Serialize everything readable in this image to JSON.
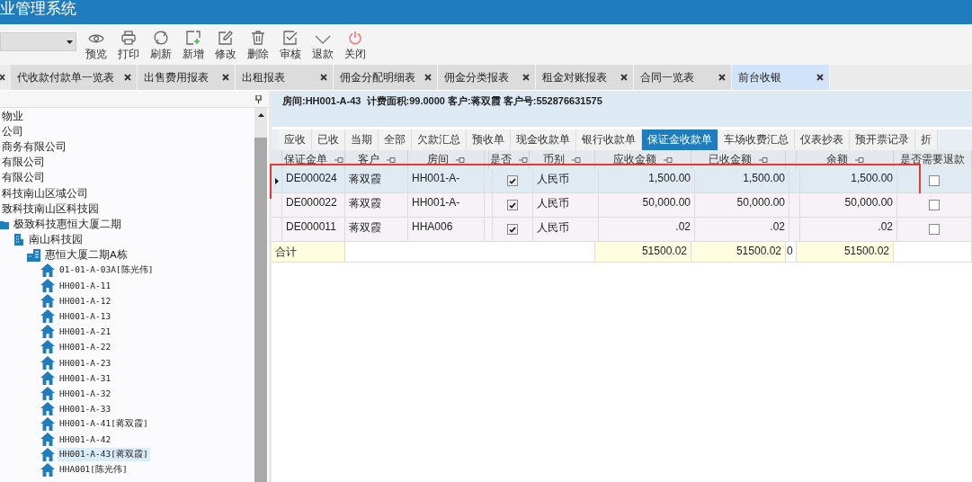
{
  "window": {
    "title": "业管理系统"
  },
  "toolbar": [
    {
      "label": "预览",
      "kind": "preview"
    },
    {
      "label": "打印",
      "kind": "print"
    },
    {
      "label": "刷新",
      "kind": "refresh"
    },
    {
      "label": "新增",
      "kind": "add"
    },
    {
      "label": "修改",
      "kind": "edit"
    },
    {
      "label": "删除",
      "kind": "delete"
    },
    {
      "label": "审核",
      "kind": "audit"
    },
    {
      "label": "退款",
      "kind": "refund"
    },
    {
      "label": "关闭",
      "kind": "close"
    }
  ],
  "tabs": [
    {
      "label": "代收款付款单一览表",
      "selected": false
    },
    {
      "label": "出售费用报表",
      "selected": false
    },
    {
      "label": "出租报表",
      "selected": false
    },
    {
      "label": "佣金分配明细表",
      "selected": false
    },
    {
      "label": "佣金分类报表",
      "selected": false
    },
    {
      "label": "租金对账报表",
      "selected": false
    },
    {
      "label": "合同一览表",
      "selected": false
    },
    {
      "label": "前台收银",
      "selected": true
    }
  ],
  "tree": [
    {
      "label": "物业"
    },
    {
      "label": "公司"
    },
    {
      "label": "商务有限公司"
    },
    {
      "label": "有限公司"
    },
    {
      "label": "有限公司"
    },
    {
      "label": "科技南山区域公司"
    },
    {
      "label": "致科技南山区科技园",
      "children": [
        {
          "label": "极致科技惠恒大厦二期",
          "kind": "estate",
          "children": [
            {
              "label": "南山科技园",
              "kind": "park",
              "children": [
                {
                  "label": "惠恒大厦二期A栋",
                  "kind": "building",
                  "children": [
                    {
                      "label": "01-01-A-03A[陈光伟]",
                      "kind": "unit",
                      "selected": false
                    },
                    {
                      "label": "HH001-A-11",
                      "kind": "unit",
                      "selected": false
                    },
                    {
                      "label": "HH001-A-12",
                      "kind": "unit",
                      "selected": false
                    },
                    {
                      "label": "HH001-A-13",
                      "kind": "unit",
                      "selected": false
                    },
                    {
                      "label": "HH001-A-21",
                      "kind": "unit",
                      "selected": false
                    },
                    {
                      "label": "HH001-A-22",
                      "kind": "unit",
                      "selected": false
                    },
                    {
                      "label": "HH001-A-23",
                      "kind": "unit",
                      "selected": false
                    },
                    {
                      "label": "HH001-A-31",
                      "kind": "unit",
                      "selected": false
                    },
                    {
                      "label": "HH001-A-32",
                      "kind": "unit",
                      "selected": false
                    },
                    {
                      "label": "HH001-A-33",
                      "kind": "unit",
                      "selected": false
                    },
                    {
                      "label": "HH001-A-41[蒋双霞]",
                      "kind": "unit",
                      "selected": false
                    },
                    {
                      "label": "HH001-A-42",
                      "kind": "unit",
                      "selected": false
                    },
                    {
                      "label": "HH001-A-43[蒋双霞]",
                      "kind": "unit",
                      "selected": true
                    },
                    {
                      "label": "HHA001[陈光伟]",
                      "kind": "unit",
                      "selected": false
                    }
                  ]
                }
              ]
            }
          ]
        }
      ]
    }
  ],
  "info": "房间:HH001-A-43  计费面积:99.0000 客户:蒋双霞 客户号:552876631575",
  "subtabs": [
    {
      "label": "应收",
      "selected": false
    },
    {
      "label": "已收",
      "selected": false
    },
    {
      "label": "当期",
      "selected": false
    },
    {
      "label": "全部",
      "selected": false
    },
    {
      "label": "欠款汇总",
      "selected": false
    },
    {
      "label": "预收单",
      "selected": false
    },
    {
      "label": "现金收款单",
      "selected": false
    },
    {
      "label": "银行收款单",
      "selected": false
    },
    {
      "label": "保证金收款单",
      "selected": true
    },
    {
      "label": "车场收费汇总",
      "selected": false
    },
    {
      "label": "仪表抄表",
      "selected": false
    },
    {
      "label": "预开票记录",
      "selected": false
    },
    {
      "label": "折",
      "selected": false
    }
  ],
  "grid": {
    "columns": [
      "保证金单",
      "客户",
      "房间",
      "是否",
      "币别",
      "应收金额",
      "已收金额",
      "余额",
      "是否需要退款"
    ],
    "rows": [
      {
        "selected": true,
        "annotated": true,
        "bill": "DE000024",
        "customer": "蒋双霞",
        "room": "HH001-A-",
        "flag": true,
        "currency": "人民币",
        "receivable": "1,500.00",
        "received": "1,500.00",
        "balance": "1,500.00",
        "refund": false
      },
      {
        "selected": false,
        "annotated": false,
        "bill": "DE000022",
        "customer": "蒋双霞",
        "room": "HH001-A-",
        "flag": true,
        "currency": "人民币",
        "receivable": "50,000.00",
        "received": "50,000.00",
        "balance": "50,000.00",
        "refund": false
      },
      {
        "selected": false,
        "annotated": false,
        "bill": "DE000011",
        "customer": "蒋双霞",
        "room": "HHA006",
        "flag": true,
        "currency": "人民币",
        "receivable": ".02",
        "received": ".02",
        "balance": ".02",
        "refund": false
      }
    ],
    "totals": {
      "label": "合计",
      "receivable": "51500.02",
      "received": "51500.02",
      "extra": "0",
      "balance": "51500.02"
    }
  }
}
